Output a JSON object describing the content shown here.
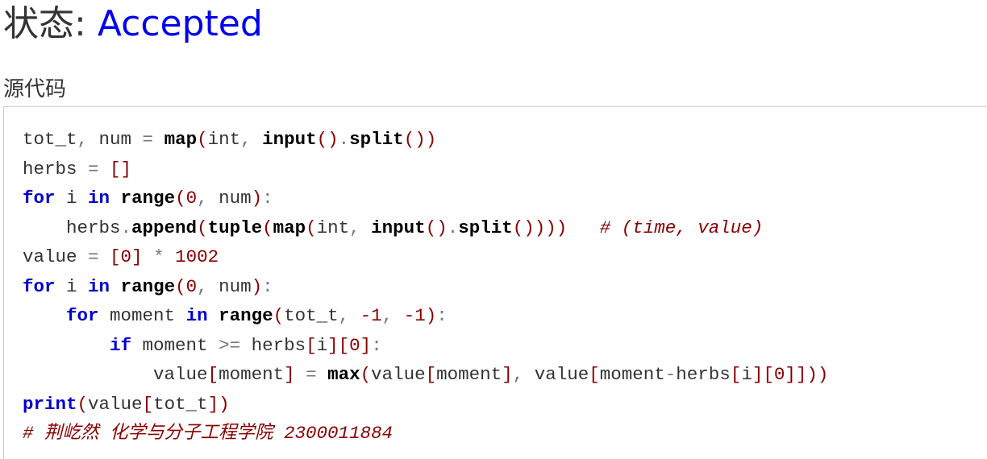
{
  "status": {
    "label": "状态: ",
    "value": "Accepted"
  },
  "source_title": "源代码",
  "code_lines": [
    [
      [
        "n",
        "tot_t"
      ],
      [
        "o",
        ", "
      ],
      [
        "n",
        "num "
      ],
      [
        "o",
        "= "
      ],
      [
        "f",
        "map"
      ],
      [
        "p",
        "("
      ],
      [
        "n",
        "int"
      ],
      [
        "o",
        ", "
      ],
      [
        "f",
        "input"
      ],
      [
        "p",
        "()"
      ],
      [
        "o",
        "."
      ],
      [
        "f",
        "split"
      ],
      [
        "p",
        "())"
      ]
    ],
    [
      [
        "n",
        "herbs "
      ],
      [
        "o",
        "= "
      ],
      [
        "p",
        "[]"
      ]
    ],
    [
      [
        "k",
        "for"
      ],
      [
        "n",
        " i "
      ],
      [
        "k",
        "in"
      ],
      [
        "n",
        " "
      ],
      [
        "f",
        "range"
      ],
      [
        "p",
        "("
      ],
      [
        "m",
        "0"
      ],
      [
        "o",
        ", "
      ],
      [
        "n",
        "num"
      ],
      [
        "p",
        ")"
      ],
      [
        "o",
        ":"
      ]
    ],
    [
      [
        "n",
        "    herbs"
      ],
      [
        "o",
        "."
      ],
      [
        "f",
        "append"
      ],
      [
        "p",
        "("
      ],
      [
        "f",
        "tuple"
      ],
      [
        "p",
        "("
      ],
      [
        "f",
        "map"
      ],
      [
        "p",
        "("
      ],
      [
        "n",
        "int"
      ],
      [
        "o",
        ", "
      ],
      [
        "f",
        "input"
      ],
      [
        "p",
        "()"
      ],
      [
        "o",
        "."
      ],
      [
        "f",
        "split"
      ],
      [
        "p",
        "()))) "
      ],
      [
        "n",
        "  "
      ],
      [
        "c",
        "# (time, value)"
      ]
    ],
    [
      [
        "n",
        "value "
      ],
      [
        "o",
        "= "
      ],
      [
        "p",
        "["
      ],
      [
        "m",
        "0"
      ],
      [
        "p",
        "]"
      ],
      [
        "o",
        " * "
      ],
      [
        "m",
        "1002"
      ]
    ],
    [
      [
        "k",
        "for"
      ],
      [
        "n",
        " i "
      ],
      [
        "k",
        "in"
      ],
      [
        "n",
        " "
      ],
      [
        "f",
        "range"
      ],
      [
        "p",
        "("
      ],
      [
        "m",
        "0"
      ],
      [
        "o",
        ", "
      ],
      [
        "n",
        "num"
      ],
      [
        "p",
        ")"
      ],
      [
        "o",
        ":"
      ]
    ],
    [
      [
        "n",
        "    "
      ],
      [
        "k",
        "for"
      ],
      [
        "n",
        " moment "
      ],
      [
        "k",
        "in"
      ],
      [
        "n",
        " "
      ],
      [
        "f",
        "range"
      ],
      [
        "p",
        "("
      ],
      [
        "n",
        "tot_t"
      ],
      [
        "o",
        ", "
      ],
      [
        "m",
        "-1"
      ],
      [
        "o",
        ", "
      ],
      [
        "m",
        "-1"
      ],
      [
        "p",
        ")"
      ],
      [
        "o",
        ":"
      ]
    ],
    [
      [
        "n",
        "        "
      ],
      [
        "k",
        "if"
      ],
      [
        "n",
        " moment "
      ],
      [
        "o",
        ">= "
      ],
      [
        "n",
        "herbs"
      ],
      [
        "p",
        "["
      ],
      [
        "n",
        "i"
      ],
      [
        "p",
        "]["
      ],
      [
        "m",
        "0"
      ],
      [
        "p",
        "]"
      ],
      [
        "o",
        ":"
      ]
    ],
    [
      [
        "n",
        "            value"
      ],
      [
        "p",
        "["
      ],
      [
        "n",
        "moment"
      ],
      [
        "p",
        "]"
      ],
      [
        "o",
        " = "
      ],
      [
        "f",
        "max"
      ],
      [
        "p",
        "("
      ],
      [
        "n",
        "value"
      ],
      [
        "p",
        "["
      ],
      [
        "n",
        "moment"
      ],
      [
        "p",
        "]"
      ],
      [
        "o",
        ", "
      ],
      [
        "n",
        "value"
      ],
      [
        "p",
        "["
      ],
      [
        "n",
        "moment"
      ],
      [
        "o",
        "-"
      ],
      [
        "n",
        "herbs"
      ],
      [
        "p",
        "["
      ],
      [
        "n",
        "i"
      ],
      [
        "p",
        "]["
      ],
      [
        "m",
        "0"
      ],
      [
        "p",
        "]]))"
      ]
    ],
    [
      [
        "k",
        "print"
      ],
      [
        "p",
        "("
      ],
      [
        "n",
        "value"
      ],
      [
        "p",
        "["
      ],
      [
        "n",
        "tot_t"
      ],
      [
        "p",
        "])"
      ]
    ],
    [
      [
        "c",
        "# 荆屹然 化学与分子工程学院 2300011884"
      ]
    ]
  ]
}
